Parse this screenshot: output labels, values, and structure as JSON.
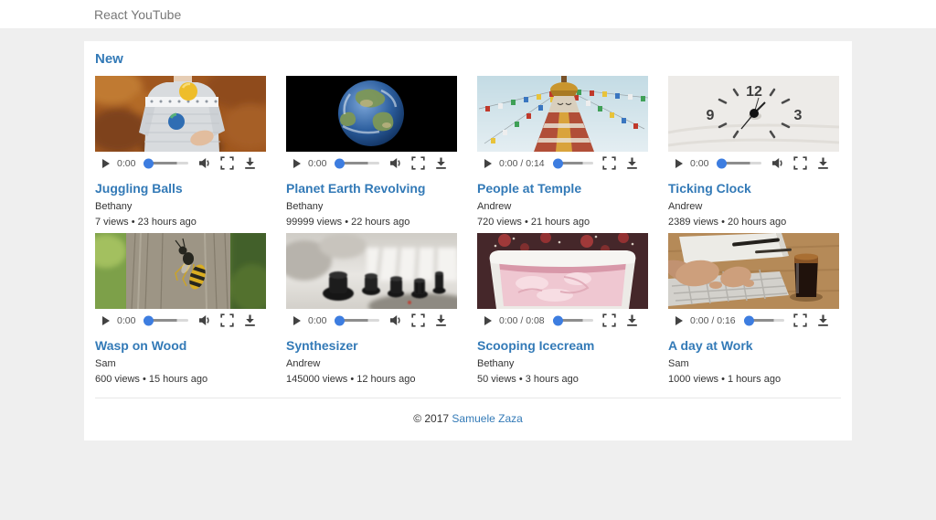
{
  "header": {
    "brand": "React YouTube"
  },
  "section": {
    "title": "New"
  },
  "videos": [
    {
      "title": "Juggling Balls",
      "author": "Bethany",
      "meta": "7 views • 23 hours ago",
      "time": "0:00",
      "has_volume": true,
      "thumb": "juggling"
    },
    {
      "title": "Planet Earth Revolving",
      "author": "Bethany",
      "meta": "99999 views • 22 hours ago",
      "time": "0:00",
      "has_volume": true,
      "thumb": "earth"
    },
    {
      "title": "People at Temple",
      "author": "Andrew",
      "meta": "720 views • 21 hours ago",
      "time": "0:00 / 0:14",
      "has_volume": false,
      "thumb": "temple"
    },
    {
      "title": "Ticking Clock",
      "author": "Andrew",
      "meta": "2389 views • 20 hours ago",
      "time": "0:00",
      "has_volume": true,
      "thumb": "clock"
    },
    {
      "title": "Wasp on Wood",
      "author": "Sam",
      "meta": "600 views • 15 hours ago",
      "time": "0:00",
      "has_volume": true,
      "thumb": "wasp"
    },
    {
      "title": "Synthesizer",
      "author": "Andrew",
      "meta": "145000 views • 12 hours ago",
      "time": "0:00",
      "has_volume": true,
      "thumb": "synth"
    },
    {
      "title": "Scooping Icecream",
      "author": "Bethany",
      "meta": "50 views • 3 hours ago",
      "time": "0:00 / 0:08",
      "has_volume": false,
      "thumb": "icecream"
    },
    {
      "title": "A day at Work",
      "author": "Sam",
      "meta": "1000 views • 1 hours ago",
      "time": "0:00 / 0:16",
      "has_volume": false,
      "thumb": "work"
    }
  ],
  "footer": {
    "copyright": "© 2017",
    "link_text": "Samuele Zaza"
  },
  "colors": {
    "accent": "#337ab7",
    "slider_handle": "#3d7de0",
    "icon": "#424242",
    "page_bg": "#efefef",
    "brand_text": "#777777"
  }
}
